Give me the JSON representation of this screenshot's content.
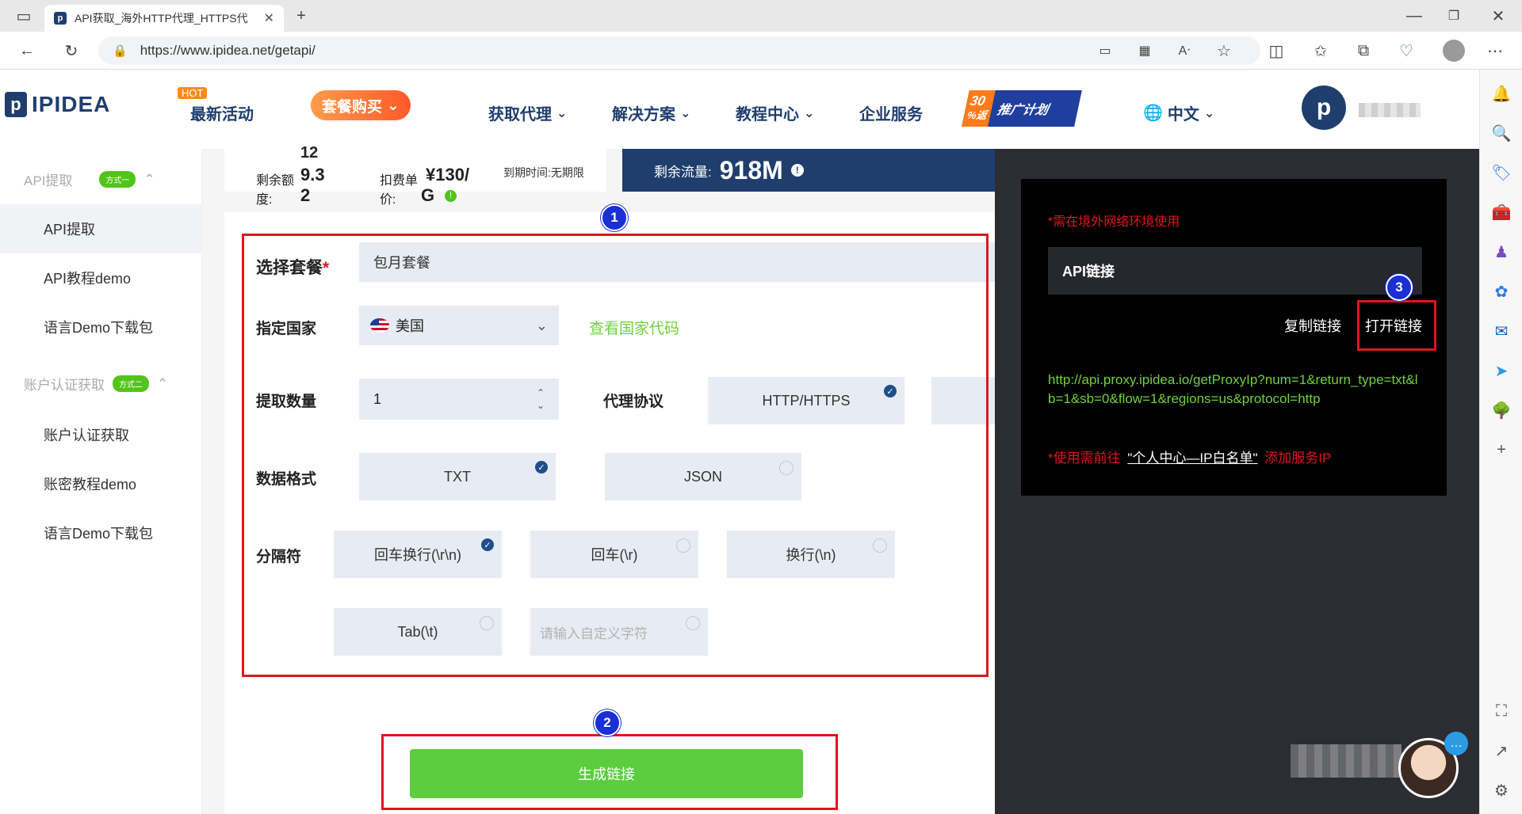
{
  "browser": {
    "tab_title": "API获取_海外HTTP代理_HTTPS代",
    "url": "https://www.ipidea.net/getapi/"
  },
  "header": {
    "logo": "IPIDEA",
    "hot_badge": "HOT",
    "latest_activity": "最新活动",
    "package_buy": "套餐购买",
    "nav": [
      "获取代理",
      "解决方案",
      "教程中心",
      "企业服务"
    ],
    "promo_top": "30",
    "promo_sub": "%返",
    "promo_label": "推广计划",
    "language": "中文",
    "avatar_logo": "p"
  },
  "sidebar": {
    "group1": {
      "label": "API提取",
      "badge": "方式一"
    },
    "group1_items": [
      "API提取",
      "API教程demo",
      "语言Demo下载包"
    ],
    "group2": {
      "label": "账户认证获取",
      "badge": "方式二"
    },
    "group2_items": [
      "账户认证获取",
      "账密教程demo",
      "语言Demo下载包"
    ]
  },
  "stats": {
    "top_number": "12",
    "balance_label_1": "剩余额",
    "balance_label_2": "度:",
    "balance_value_1": "9.3",
    "balance_value_2": "2",
    "deduct_label_1": "扣费单",
    "deduct_label_2": "价:",
    "deduct_value_1": "¥130/",
    "deduct_value_2": "G",
    "expire_text": "到期时间:无期限",
    "traffic_label": "剩余流量:",
    "traffic_value": "918M"
  },
  "form": {
    "package_label": "选择套餐",
    "required_mark": "*",
    "package_value": "包月套餐",
    "country_label": "指定国家",
    "country_value": "美国",
    "country_link": "查看国家代码",
    "quantity_label": "提取数量",
    "quantity_value": "1",
    "protocol_label": "代理协议",
    "protocol_option": "HTTP/HTTPS",
    "format_label": "数据格式",
    "format_options": [
      "TXT",
      "JSON"
    ],
    "separator_label": "分隔符",
    "separator_options": [
      "回车换行(\\r\\n)",
      "回车(\\r)",
      "换行(\\n)",
      "Tab(\\t)"
    ],
    "custom_placeholder": "请输入自定义字符",
    "generate_button": "生成链接"
  },
  "api_panel": {
    "env_note": "*需在境外网络环境使用",
    "api_link_label": "API链接",
    "copy_link": "复制链接",
    "open_link": "打开链接",
    "api_url": "http://api.proxy.ipidea.io/getProxyIp?num=1&return_type=txt&lb=1&sb=0&flow=1&regions=us&protocol=http",
    "whitelist_prefix": "*使用需前往",
    "whitelist_link": "\"个人中心—IP白名单\"",
    "whitelist_suffix": "添加服务IP"
  },
  "annotations": [
    "1",
    "2",
    "3"
  ],
  "colors": {
    "navy": "#1f3e6e",
    "green": "#5ccd3e",
    "red": "#e0151b",
    "annotation_blue": "#1a2fd6",
    "link_green": "#6fd23a"
  }
}
